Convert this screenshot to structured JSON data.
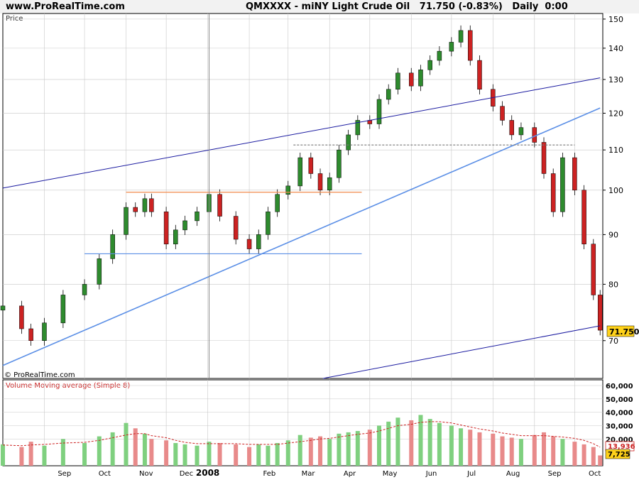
{
  "header": {
    "site": "www.ProRealTime.com",
    "title": "QMXXXX - miNY Light Crude Oil   71.750 (-0.83%)   Daily  0:00"
  },
  "price_panel": {
    "label": "Price",
    "watermark": "© ProRealTime.com",
    "last_price_label": "71.750"
  },
  "volume_panel": {
    "label": "Volume Moving average (Simple 8)",
    "ma_label": "13,936",
    "last_volume_label": "7,725"
  },
  "colors": {
    "up": "#2e8b2e",
    "down": "#cc2222",
    "channel": "#1a1aa0",
    "trend": "#5b8fe6",
    "resistance": "#f08a4b",
    "support": "#5b8fe6",
    "grid": "#c8c8c8",
    "vol_up": "#7fd07f",
    "vol_down": "#e88a8a",
    "ma": "#cc2222"
  },
  "chart_data": [
    {
      "type": "candlestick",
      "title": "QMXXXX - miNY Light Crude Oil",
      "ylabel": "Price",
      "y_scale": "log",
      "ylim": [
        64,
        152
      ],
      "y_ticks": [
        70,
        80,
        90,
        100,
        110,
        120,
        130,
        140,
        150
      ],
      "x_ticks": [
        "Sep",
        "Oct",
        "Nov",
        "Dec",
        "2008",
        "Feb",
        "Mar",
        "Apr",
        "May",
        "Jun",
        "Jul",
        "Aug",
        "Sep",
        "Oct"
      ],
      "grid": true,
      "x": [
        "2007-08-01",
        "2007-08-15",
        "2007-08-22",
        "2007-09-01",
        "2007-09-15",
        "2007-10-01",
        "2007-10-12",
        "2007-10-22",
        "2007-11-01",
        "2007-11-08",
        "2007-11-15",
        "2007-11-20",
        "2007-12-01",
        "2007-12-08",
        "2007-12-15",
        "2007-12-24",
        "2008-01-02",
        "2008-01-10",
        "2008-01-22",
        "2008-02-01",
        "2008-02-08",
        "2008-02-15",
        "2008-02-22",
        "2008-03-01",
        "2008-03-10",
        "2008-03-18",
        "2008-03-25",
        "2008-04-01",
        "2008-04-08",
        "2008-04-15",
        "2008-04-22",
        "2008-05-01",
        "2008-05-08",
        "2008-05-15",
        "2008-05-22",
        "2008-06-01",
        "2008-06-08",
        "2008-06-15",
        "2008-06-22",
        "2008-07-01",
        "2008-07-08",
        "2008-07-15",
        "2008-07-22",
        "2008-08-01",
        "2008-08-08",
        "2008-08-15",
        "2008-08-22",
        "2008-09-01",
        "2008-09-08",
        "2008-09-15",
        "2008-09-22",
        "2008-10-01",
        "2008-10-08",
        "2008-10-15",
        "2008-10-20"
      ],
      "series": [
        {
          "name": "QMXXXX",
          "values": [
            76,
            72,
            70,
            73,
            78,
            80,
            85,
            90,
            96,
            95,
            98,
            95,
            88,
            91,
            93,
            95,
            99,
            94,
            89,
            87,
            90,
            95,
            99,
            101,
            108,
            104,
            100,
            103,
            110,
            114,
            118,
            117,
            124,
            127,
            132,
            128,
            133,
            136,
            139,
            142,
            146,
            136,
            127,
            122,
            118,
            114,
            116,
            112,
            104,
            95,
            108,
            100,
            88,
            78,
            71.75
          ]
        }
      ],
      "annotations": [
        {
          "type": "trendline",
          "from": [
            "2007-08-01",
            100.5
          ],
          "to": [
            "2008-10-20",
            130.5
          ],
          "label": "upper channel"
        },
        {
          "type": "trendline",
          "from": [
            "2007-08-01",
            66
          ],
          "to": [
            "2008-10-20",
            121.5
          ],
          "label": "support trend"
        },
        {
          "type": "trendline",
          "from": [
            "2008-03-27",
            64
          ],
          "to": [
            "2008-10-20",
            72.5
          ],
          "label": "lower channel"
        },
        {
          "type": "hline",
          "y": 99.5,
          "from": "2007-11-01",
          "to": "2008-04-25",
          "label": "resistance"
        },
        {
          "type": "hline",
          "y": 86,
          "from": "2007-10-01",
          "to": "2008-04-25",
          "label": "support"
        },
        {
          "type": "hline",
          "y": 111.3,
          "from": "2008-03-05",
          "to": "2008-10-01",
          "label": "dotted level"
        },
        {
          "type": "vline",
          "x": "2008-01-02"
        }
      ]
    },
    {
      "type": "bar",
      "title": "Volume Moving average (Simple 8)",
      "ylim": [
        0,
        60000
      ],
      "y_ticks": [
        20000,
        30000,
        40000,
        50000,
        60000
      ],
      "x_ticks": [
        "Sep",
        "Oct",
        "Nov",
        "Dec",
        "2008",
        "Feb",
        "Mar",
        "Apr",
        "May",
        "Jun",
        "Jul",
        "Aug",
        "Sep",
        "Oct"
      ],
      "series": [
        {
          "name": "Volume",
          "values": [
            16000,
            14000,
            18000,
            15000,
            20000,
            17000,
            22000,
            25000,
            32000,
            28000,
            24000,
            20000,
            19000,
            17000,
            16000,
            15000,
            18000,
            17000,
            16000,
            14000,
            16000,
            15000,
            17000,
            19000,
            23000,
            21000,
            22000,
            20000,
            24000,
            25000,
            26000,
            27000,
            30000,
            33000,
            36000,
            34000,
            38000,
            35000,
            32000,
            30000,
            28000,
            27000,
            25000,
            24000,
            22000,
            21000,
            20000,
            23000,
            25000,
            22000,
            20000,
            18000,
            16000,
            14000,
            7725
          ]
        },
        {
          "name": "Volume Moving average (Simple 8)",
          "values": [
            15500,
            15000,
            15500,
            16000,
            17000,
            17500,
            19000,
            21000,
            23000,
            24000,
            24000,
            22500,
            21000,
            19000,
            17500,
            16500,
            16500,
            16500,
            16500,
            16000,
            16000,
            16000,
            16000,
            17000,
            18000,
            19000,
            20000,
            20500,
            21500,
            22500,
            23500,
            24500,
            26000,
            28000,
            30000,
            31000,
            32500,
            33000,
            33000,
            32000,
            30500,
            29000,
            27500,
            26000,
            24500,
            23500,
            22500,
            22500,
            22500,
            22000,
            21500,
            20500,
            19000,
            16500,
            13936
          ]
        }
      ]
    }
  ]
}
